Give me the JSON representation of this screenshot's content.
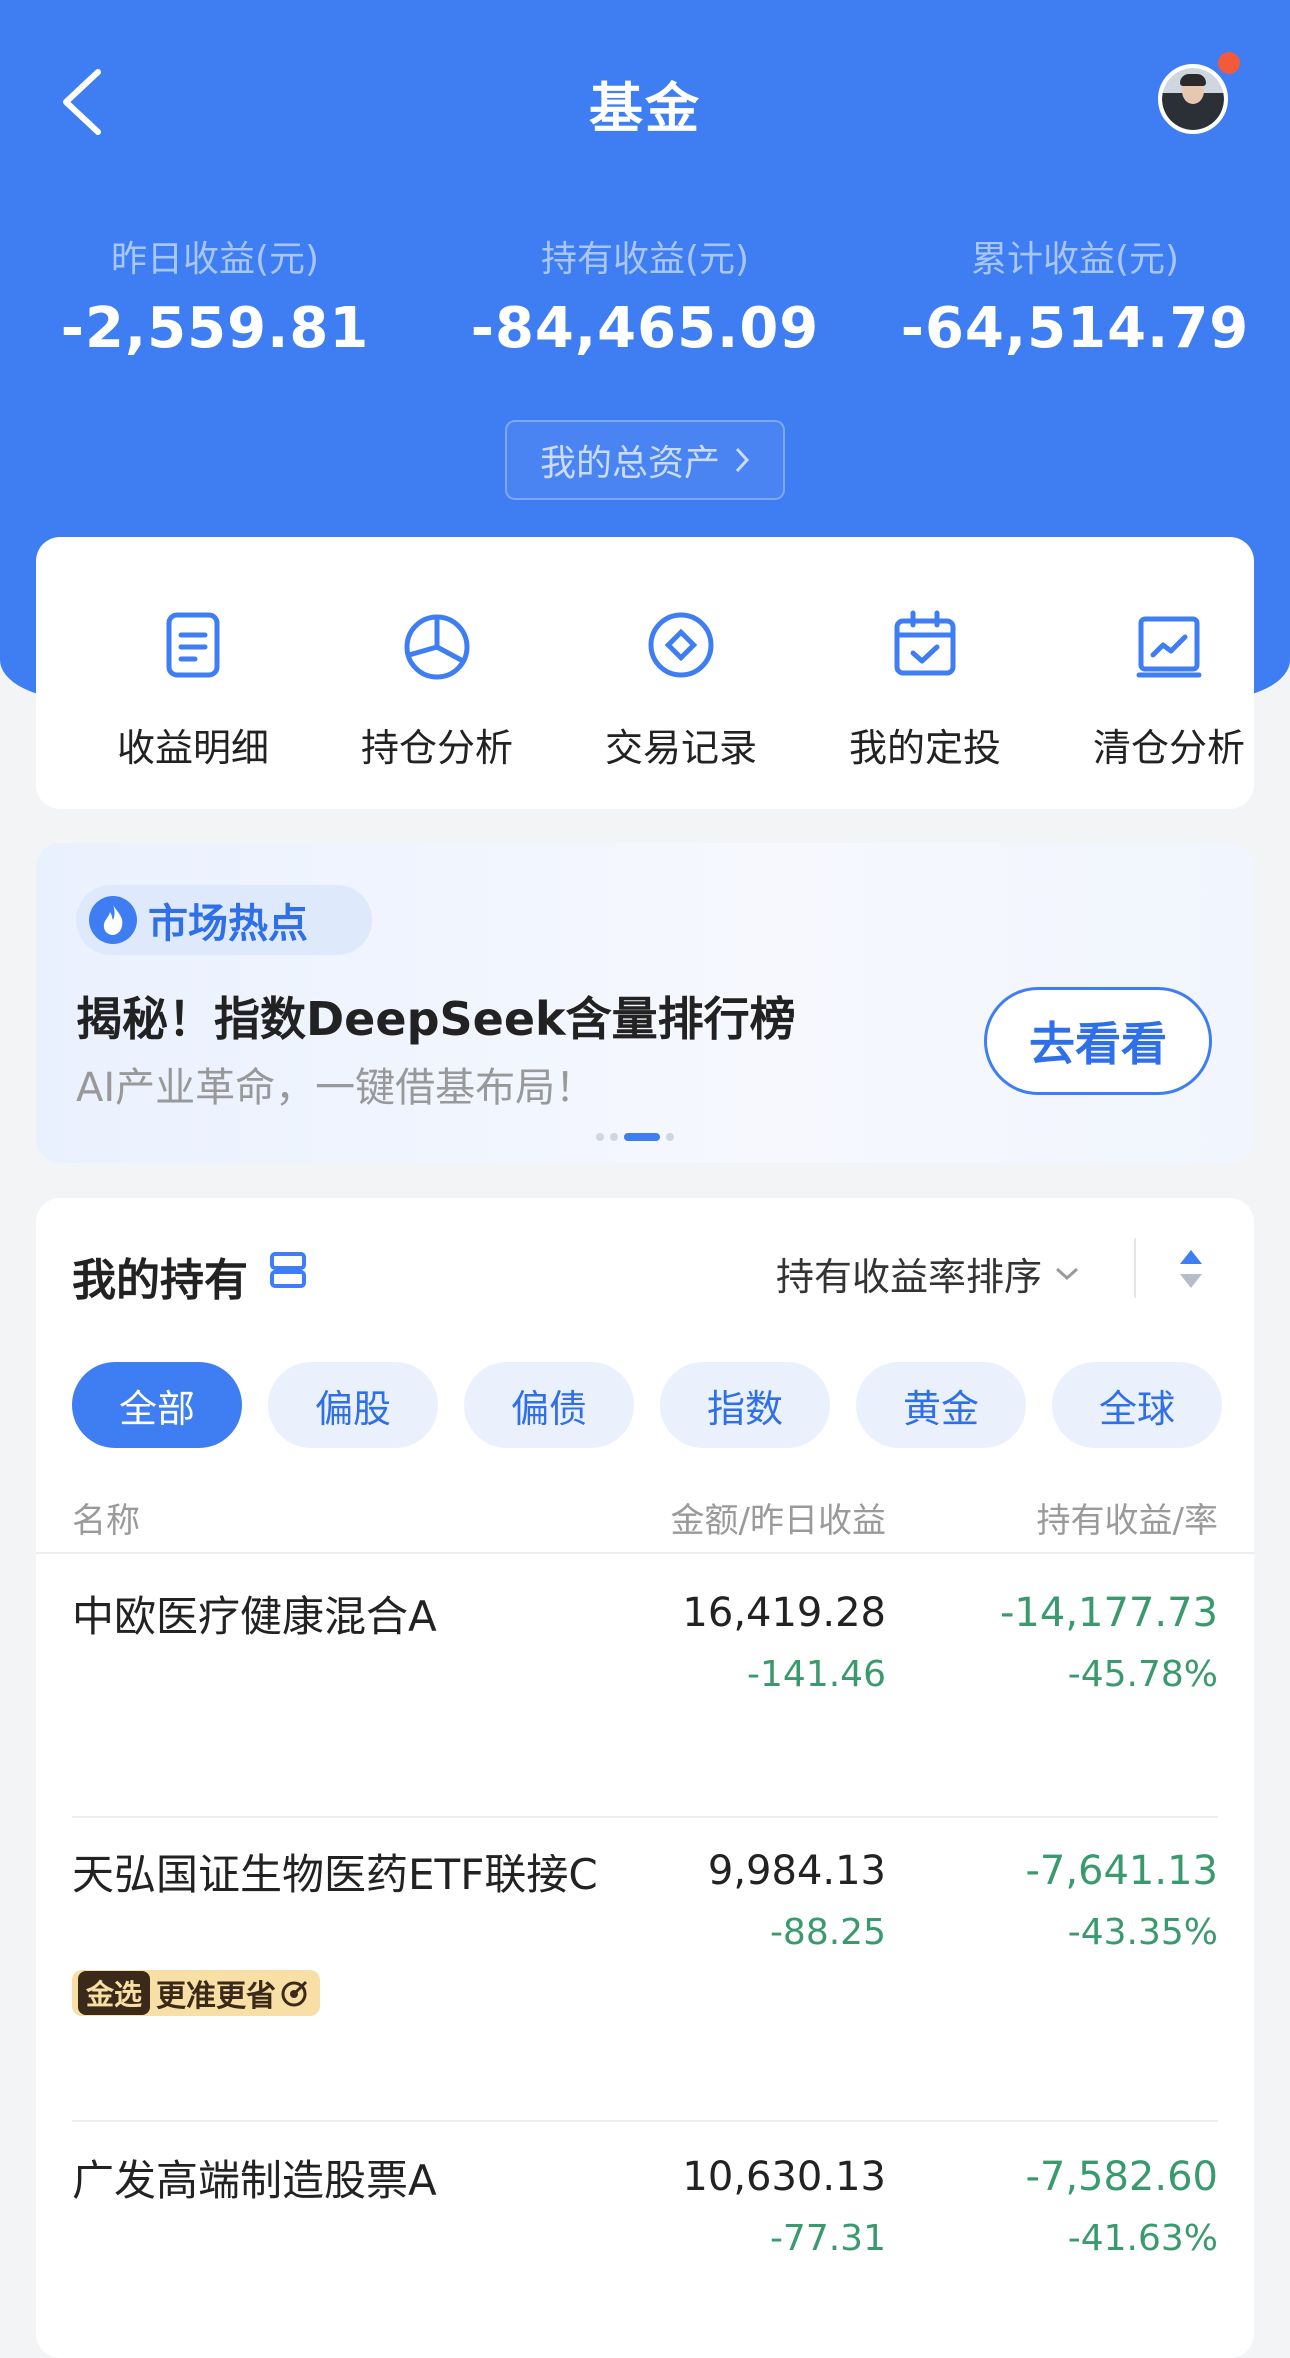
{
  "header": {
    "title": "基金",
    "stats": [
      {
        "label": "昨日收益(元)",
        "value": "-2,559.81"
      },
      {
        "label": "持有收益(元)",
        "value": "-84,465.09"
      },
      {
        "label": "累计收益(元)",
        "value": "-64,514.79"
      }
    ],
    "assets_button": "我的总资产"
  },
  "quick_actions": [
    {
      "label": "收益明细",
      "icon": "document-icon"
    },
    {
      "label": "持仓分析",
      "icon": "pie-chart-icon"
    },
    {
      "label": "交易记录",
      "icon": "record-coin-icon"
    },
    {
      "label": "我的定投",
      "icon": "calendar-check-icon"
    },
    {
      "label": "清仓分析",
      "icon": "trend-board-icon"
    }
  ],
  "promo": {
    "tag": "市场热点",
    "title": "揭秘！指数DeepSeek含量排行榜",
    "subtitle": "AI产业革命，一键借基布局！",
    "button": "去看看",
    "active_dot": 2,
    "dot_count": 4
  },
  "holdings": {
    "title": "我的持有",
    "sort_label": "持有收益率排序",
    "tabs": [
      "全部",
      "偏股",
      "偏债",
      "指数",
      "黄金",
      "全球"
    ],
    "active_tab": 0,
    "columns": {
      "name": "名称",
      "amount": "金额/昨日收益",
      "hold": "持有收益/率"
    },
    "rows": [
      {
        "name": "中欧医疗健康混合A",
        "amount": "16,419.28",
        "yesterday": "-141.46",
        "hold": "-14,177.73",
        "rate": "-45.78%"
      },
      {
        "name": "天弘国证生物医药ETF联接C",
        "amount": "9,984.13",
        "yesterday": "-88.25",
        "hold": "-7,641.13",
        "rate": "-43.35%",
        "badge_tag": "金选",
        "badge_text": "更准更省"
      },
      {
        "name": "广发高端制造股票A",
        "amount": "10,630.13",
        "yesterday": "-77.31",
        "hold": "-7,582.60",
        "rate": "-41.63%"
      }
    ]
  },
  "colors": {
    "primary": "#3f7df2",
    "loss_green": "#3a9a6e",
    "notify_red": "#f45a3a"
  }
}
